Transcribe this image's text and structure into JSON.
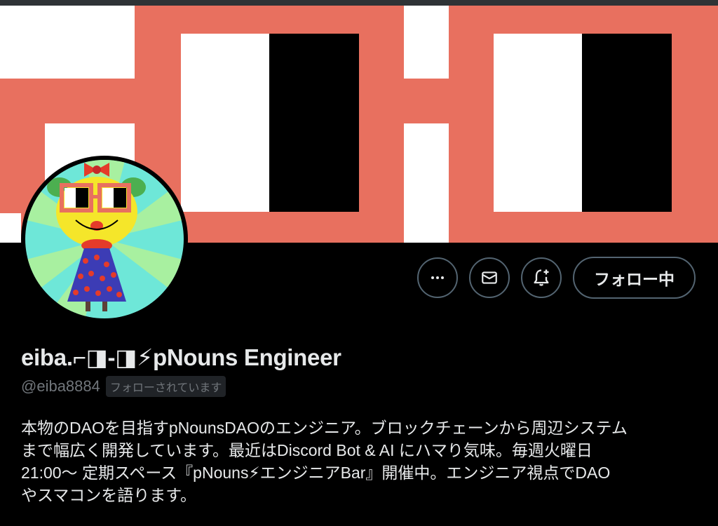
{
  "profile": {
    "display_name": "eiba.⌐◨-◨⚡pNouns Engineer",
    "handle": "@eiba8884",
    "follows_you_badge": "フォローされています",
    "bio_lines": [
      "本物のDAOを目指すpNounsDAOのエンジニア。ブロックチェーンから周辺システム",
      "まで幅広く開発しています。最近はDiscord Bot & AI にハマり気味。毎週火曜日",
      "21:00〜 定期スペース『pNouns⚡エンジニアBar』開催中。エンジニア視点でDAO",
      "やスマコンを語ります。"
    ]
  },
  "actions": {
    "more_icon": "more-horizontal-icon",
    "message_icon": "mail-icon",
    "notify_icon": "bell-plus-icon",
    "follow_label": "フォロー中"
  },
  "colors": {
    "banner_coral": "#e8705f",
    "banner_white": "#ffffff",
    "banner_black": "#000000",
    "muted_text": "#71767b",
    "border": "#536471"
  }
}
